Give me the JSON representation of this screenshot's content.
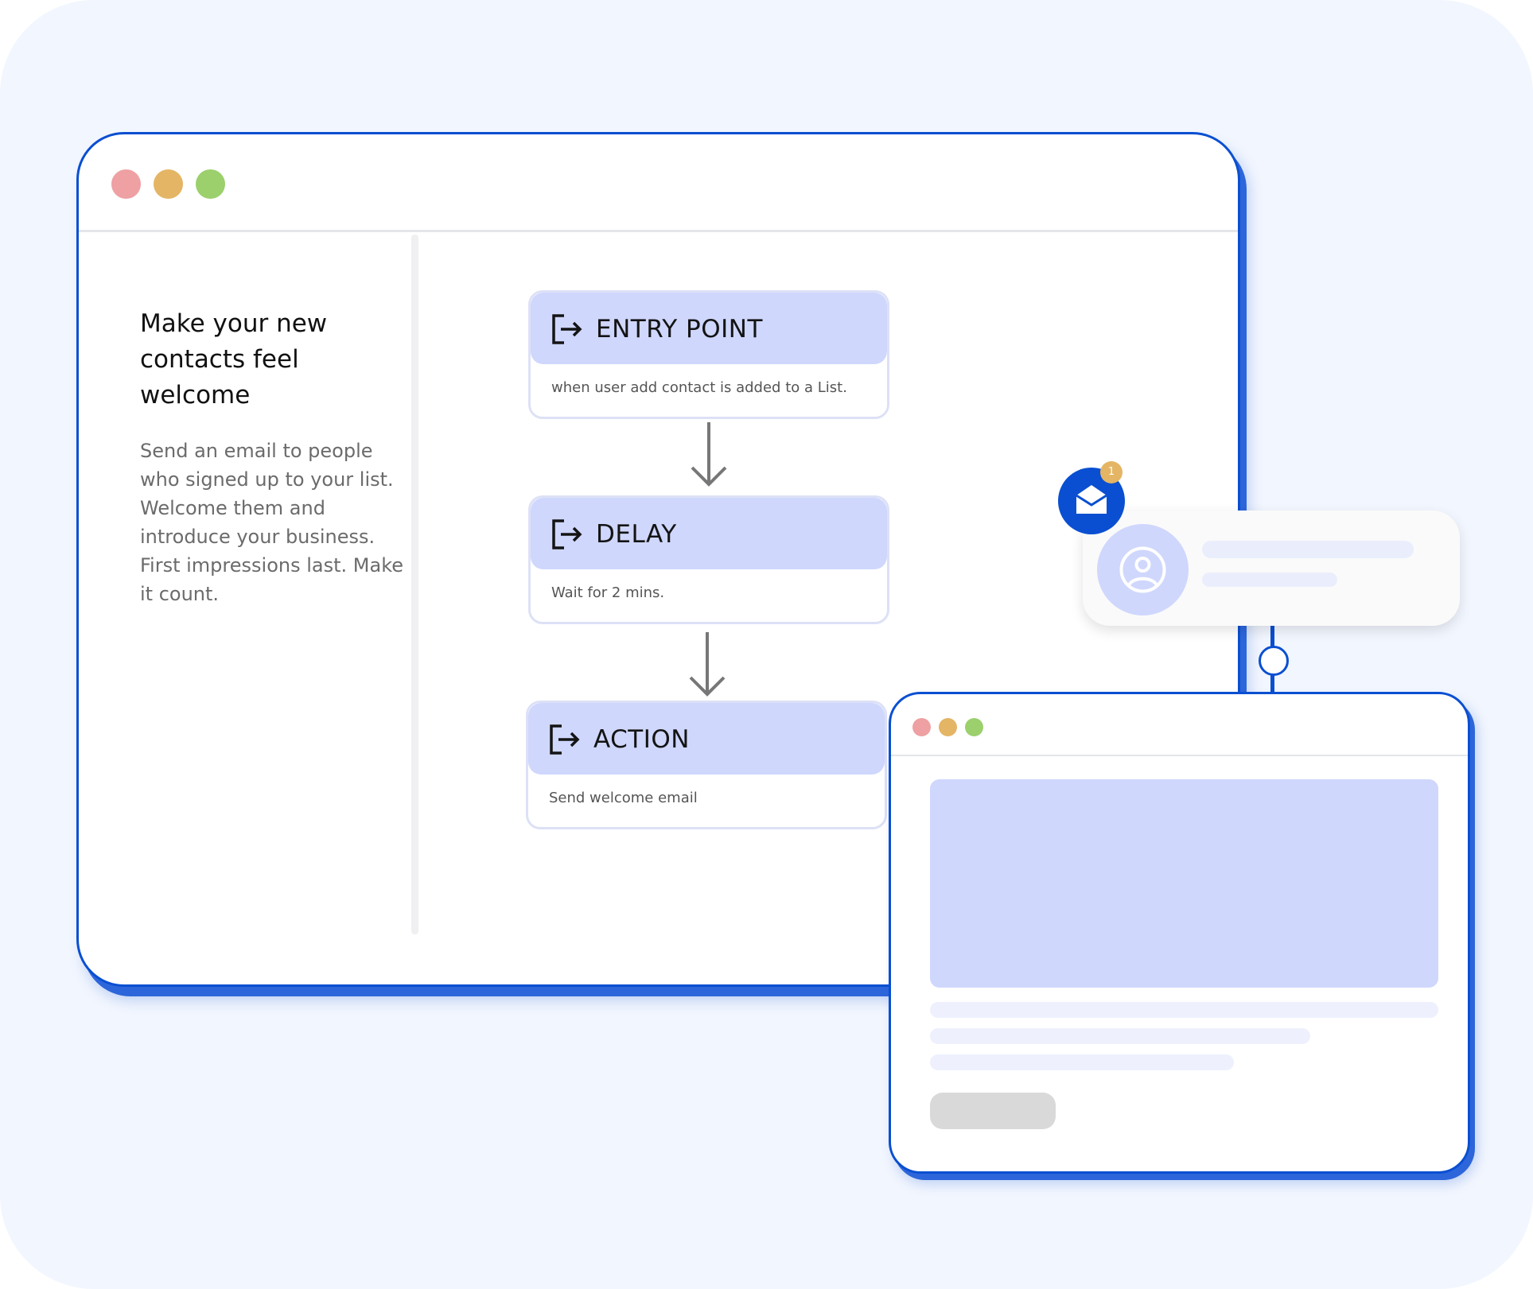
{
  "main_window": {
    "heading": "Make your new contacts feel welcome",
    "description": "Send an email to people who signed up to your list. Welcome them and introduce your business. First impressions last. Make it count."
  },
  "flow": {
    "steps": [
      {
        "title": "ENTRY POINT",
        "subtitle": "when user add contact is added to a List.",
        "icon": "exit-arrow-icon"
      },
      {
        "title": "DELAY",
        "subtitle": "Wait for 2 mins.",
        "icon": "exit-arrow-icon"
      },
      {
        "title": "ACTION",
        "subtitle": "Send welcome email",
        "icon": "exit-arrow-icon"
      }
    ]
  },
  "notification": {
    "badge_count": "1",
    "icon": "open-envelope-icon",
    "avatar_icon": "user-avatar-icon"
  },
  "colors": {
    "brand_blue": "#0a4fd1",
    "card_header": "#cfd7fd",
    "window_red": "#eea0a2",
    "window_yellow": "#e4b564",
    "window_green": "#9bd06c"
  }
}
